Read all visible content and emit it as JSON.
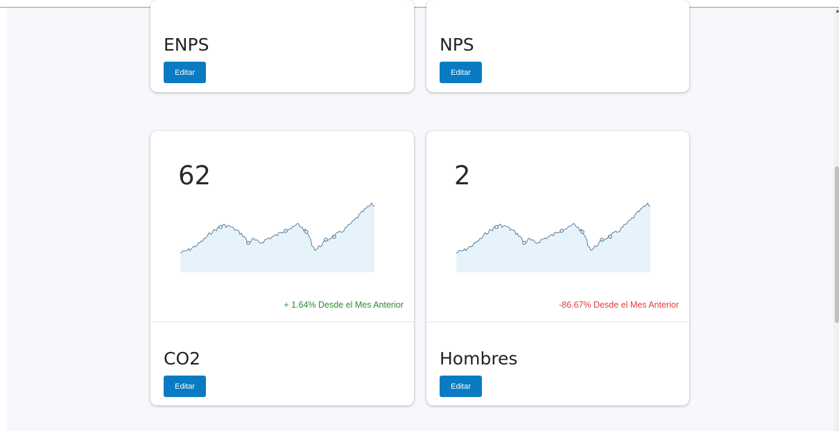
{
  "cards_top": [
    {
      "title": "ENPS",
      "edit_label": "Editar"
    },
    {
      "title": "NPS",
      "edit_label": "Editar"
    }
  ],
  "cards_bottom": [
    {
      "value": "62",
      "change_text": "+ 1.64% Desde el Mes Anterior",
      "change_color": "#2e8b2e",
      "title": "CO2",
      "edit_label": "Editar"
    },
    {
      "value": "2",
      "change_text": "-86.67% Desde el Mes Anterior",
      "change_color": "#e53935",
      "title": "Hombres",
      "edit_label": "Editar"
    }
  ],
  "colors": {
    "button": "#0a7bc2",
    "spark_line": "#5b7a9a",
    "spark_fill": "#e6f3fa",
    "page_bg": "#f6f8fc"
  },
  "scrollbar": {
    "arrow_icon": "chevron-up-icon"
  }
}
